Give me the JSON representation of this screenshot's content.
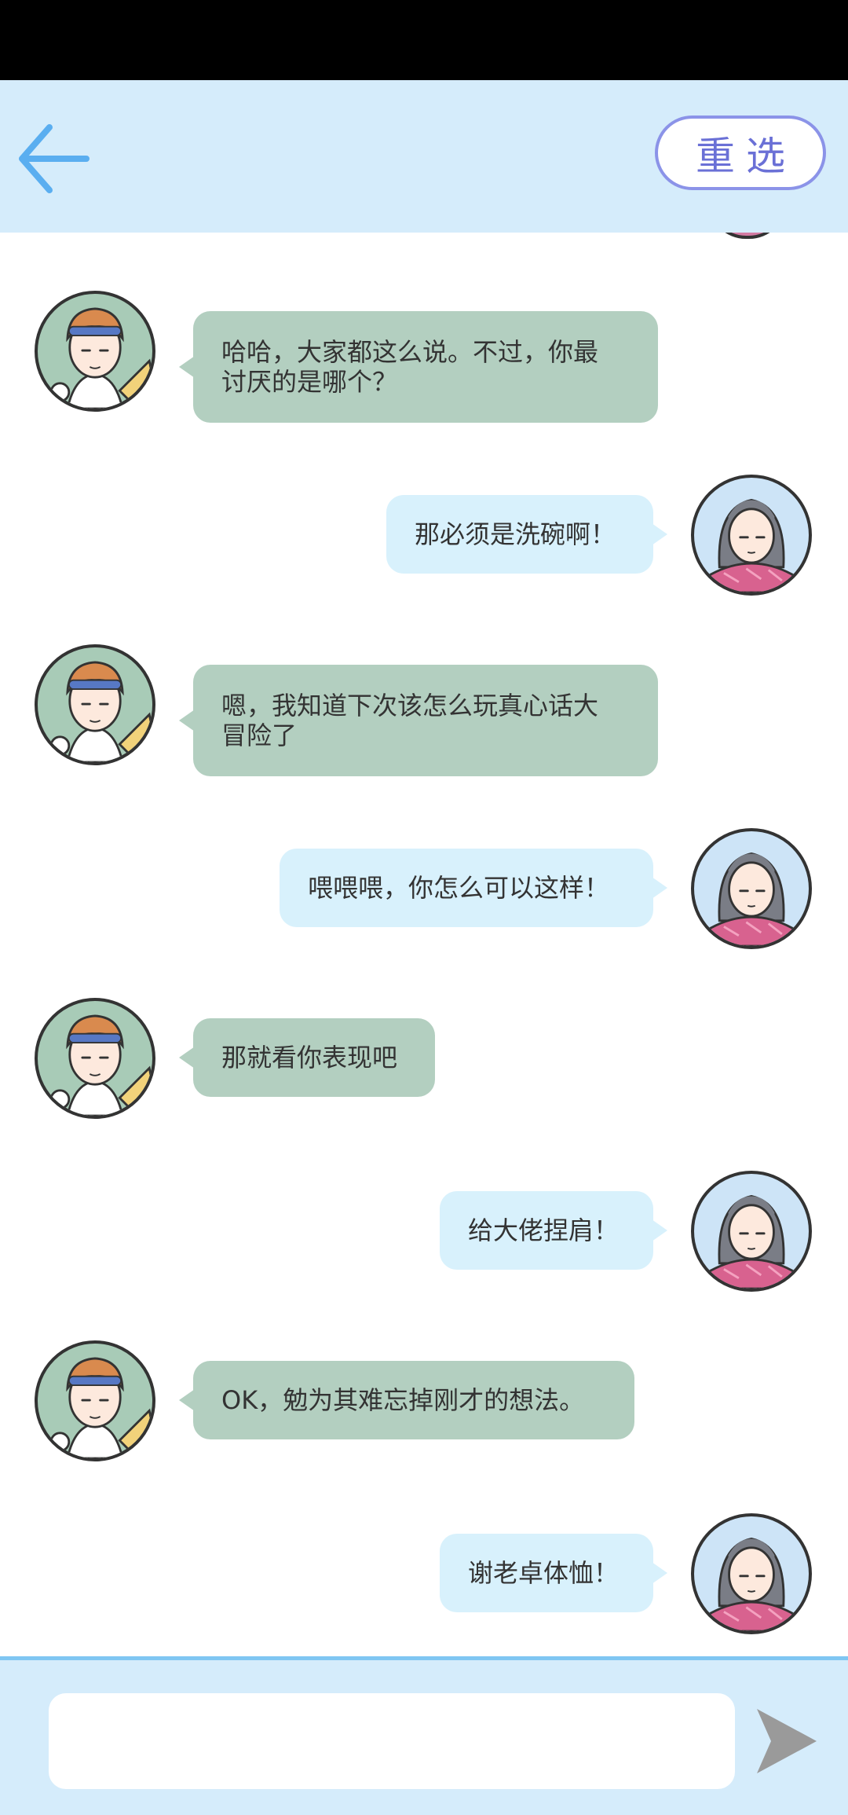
{
  "header": {
    "back_icon": "arrow-left-icon",
    "reselect_label": "重选"
  },
  "messages": [
    {
      "sender": "boy",
      "text": "哈哈，大家都这么说。不过，你最\n讨厌的是哪个？"
    },
    {
      "sender": "girl",
      "text": "那必须是洗碗啊！"
    },
    {
      "sender": "boy",
      "text": "嗯，我知道下次该怎么玩真心话大\n冒险了"
    },
    {
      "sender": "girl",
      "text": "喂喂喂，你怎么可以这样！"
    },
    {
      "sender": "boy",
      "text": "那就看你表现吧"
    },
    {
      "sender": "girl",
      "text": "给大佬捏肩！"
    },
    {
      "sender": "boy",
      "text": "OK，勉为其难忘掉刚才的想法。"
    },
    {
      "sender": "girl",
      "text": "谢老卓体恤！"
    }
  ],
  "input": {
    "placeholder": "",
    "value": ""
  },
  "send_icon": "send-arrow-icon",
  "colors": {
    "header_bg": "#d5ecfb",
    "boy_bubble": "#b3cfc0",
    "girl_bubble": "#d8f1fc",
    "accent_blue": "#5aaef0",
    "reselect_border": "#8b93e8",
    "send_icon": "#9a9a9a"
  }
}
